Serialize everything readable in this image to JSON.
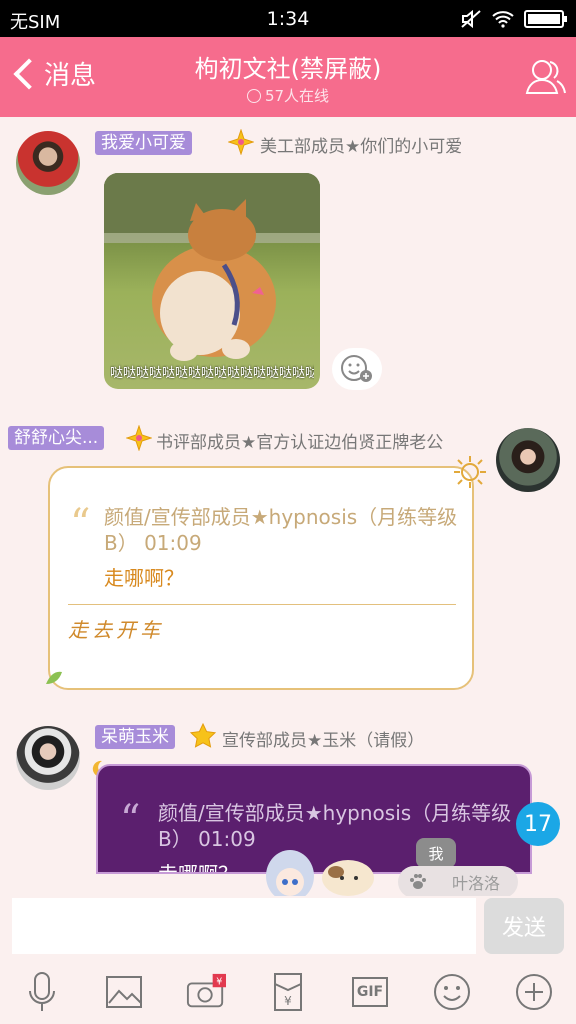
{
  "status_bar": {
    "carrier": "无SIM",
    "time": "1:34"
  },
  "header": {
    "back_label": "消息",
    "title": "枸初文社(禁屏蔽)",
    "online_count": "57人在线"
  },
  "messages": [
    {
      "name": "我爱小可爱",
      "role": "美工部成员★你们的小可爱",
      "image_caption": "哒哒哒哒哒哒哒哒哒哒哒哒哒哒哒哒哒哒哒哒"
    },
    {
      "name": "舒舒心尖...",
      "role": "书评部成员★官方认证边伯贤正牌老公",
      "quote_text": "颜值/宣传部成员★hypnosis（月练等级B） 01:09",
      "quote_reply": "走哪啊？",
      "reply": "走去开车"
    },
    {
      "name": "呆萌玉米",
      "role": "宣传部成员★玉米（请假）",
      "quote_text": "颜值/宣传部成员★hypnosis（月练等级B） 01:09",
      "quote_reply": "走哪啊？"
    }
  ],
  "unread_count": "17",
  "typing": {
    "me_label": "我",
    "user": "叶洛洛"
  },
  "input": {
    "placeholder": "",
    "send_label": "发送"
  },
  "toolbar": {
    "icons": [
      "microphone-icon",
      "image-icon",
      "camera-icon",
      "red-packet-icon",
      "gif-icon",
      "emoji-icon",
      "plus-icon"
    ],
    "gif_label": "GIF",
    "red_packet_symbol": "¥"
  },
  "colors": {
    "header": "#f66c8d",
    "name_tag": "#a78cd9",
    "quote_border": "#e6c179",
    "unread": "#1ba7e6",
    "dark_card": "#5b1f6e"
  }
}
